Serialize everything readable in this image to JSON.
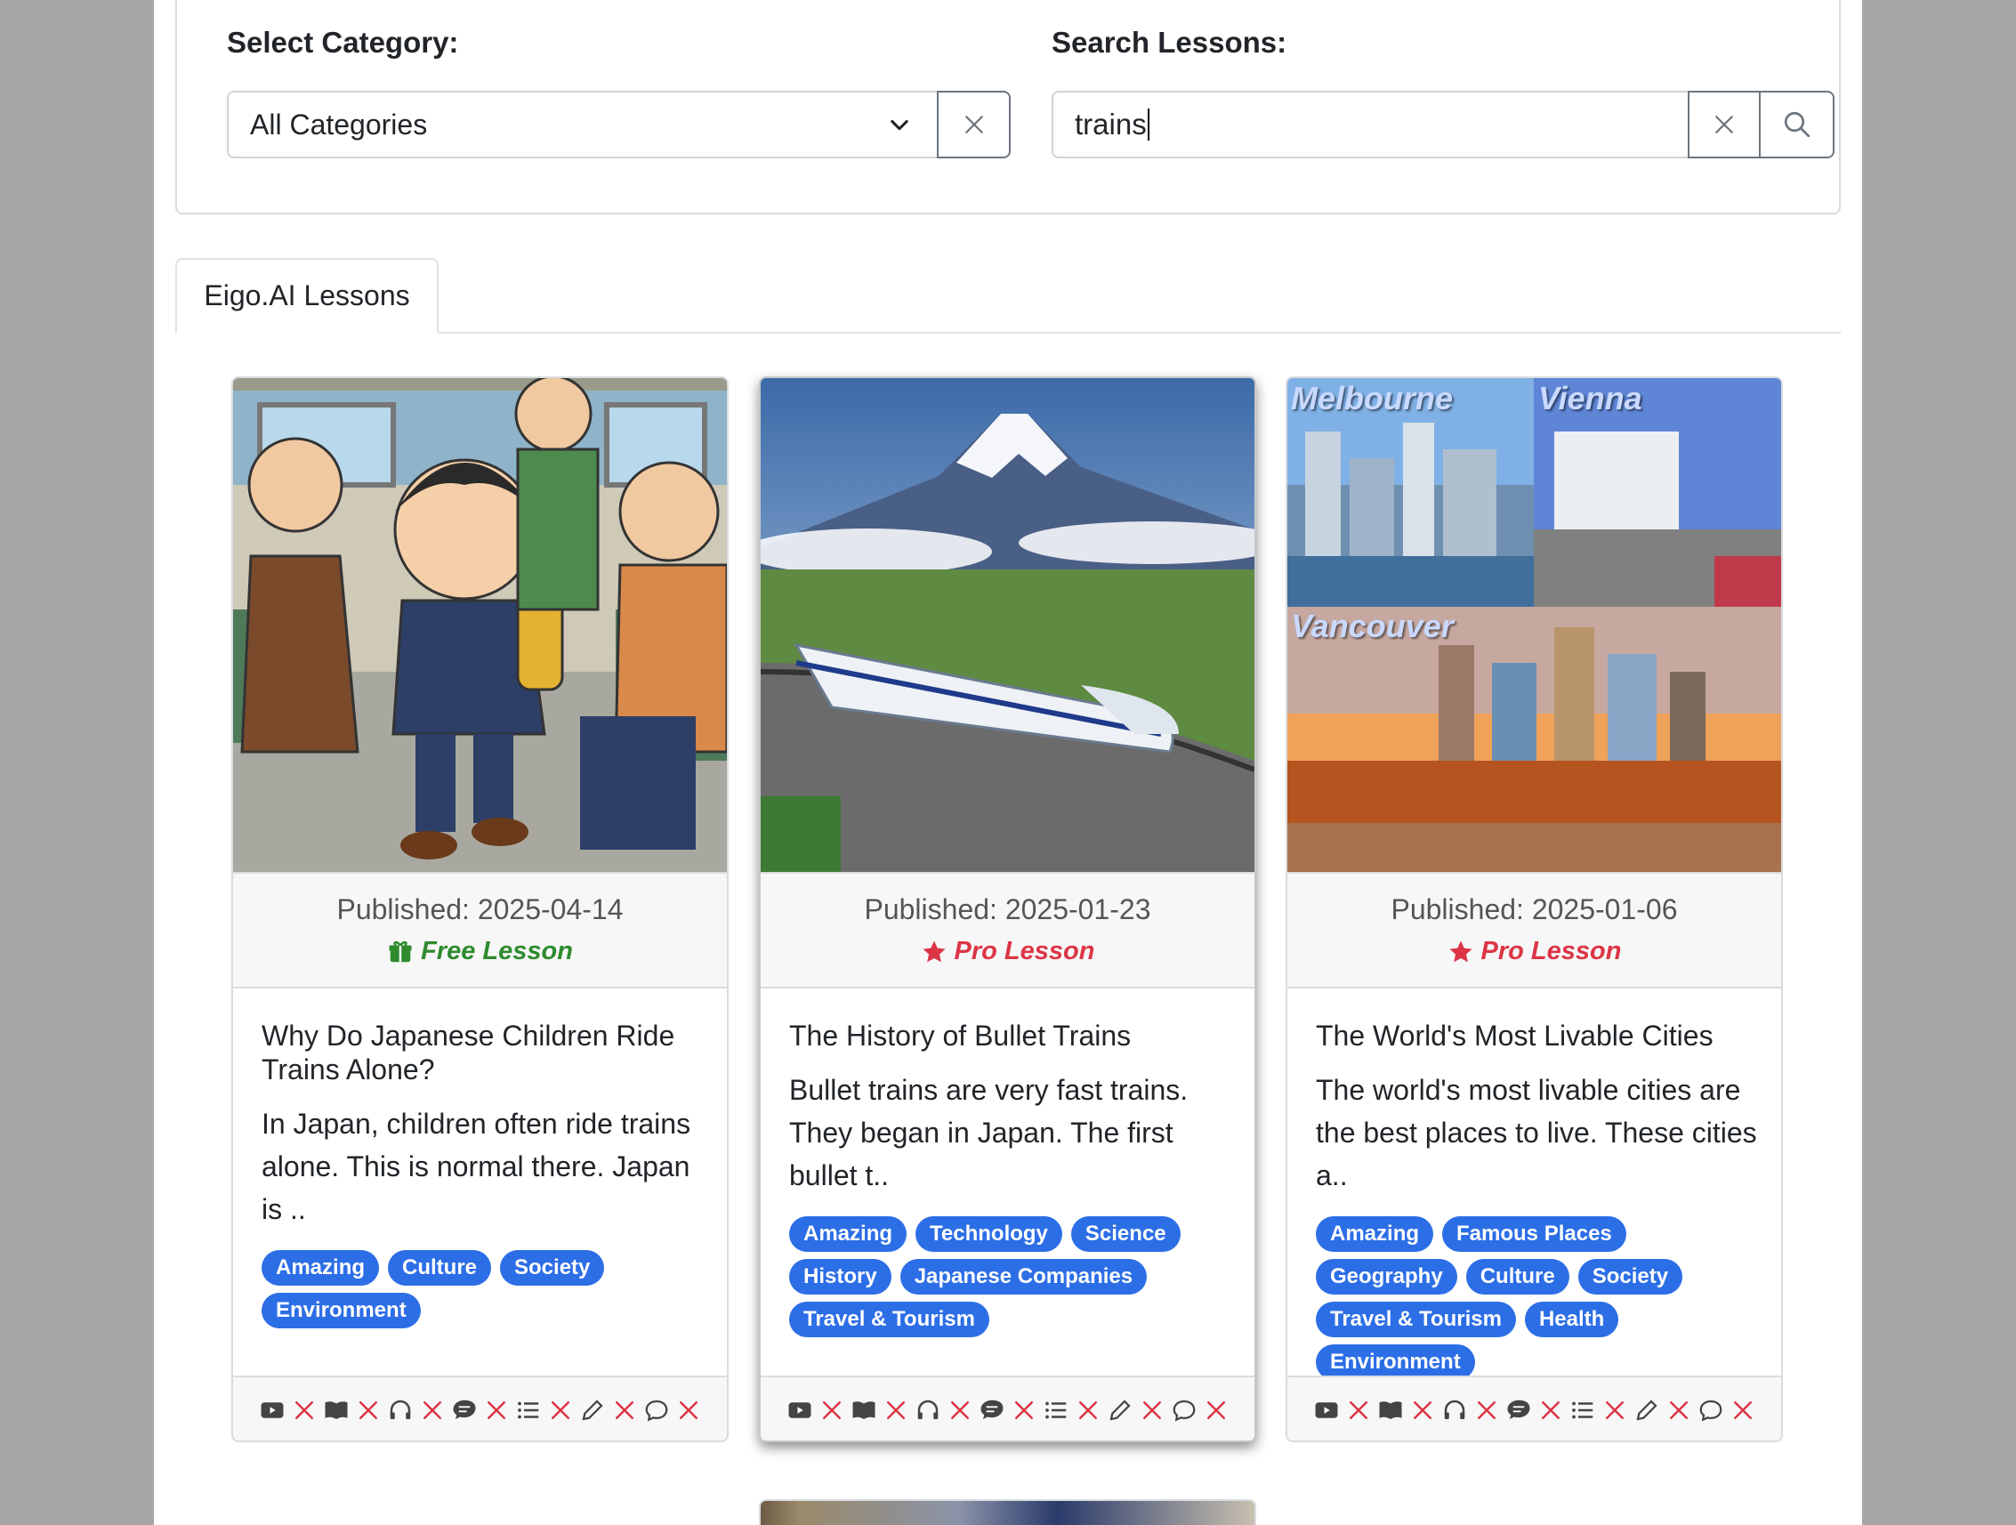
{
  "filters": {
    "category_label": "Select Category:",
    "category_selected": "All Categories",
    "search_label": "Search Lessons:",
    "search_value": "trains"
  },
  "tabs": [
    {
      "label": "Eigo.AI Lessons"
    }
  ],
  "cards": [
    {
      "published": "Published: 2025-04-14",
      "lesson_type": "Free Lesson",
      "title": "Why Do Japanese Children Ride Trains Alone?",
      "description": "In Japan, children often ride trains alone. This is normal there. Japan is ..",
      "tags": [
        "Amazing",
        "Culture",
        "Society",
        "Environment"
      ]
    },
    {
      "published": "Published: 2025-01-23",
      "lesson_type": "Pro Lesson",
      "title": "The History of Bullet Trains",
      "description": "Bullet trains are very fast trains. They began in Japan. The first bullet t..",
      "tags": [
        "Amazing",
        "Technology",
        "Science",
        "History",
        "Japanese Companies",
        "Travel & Tourism"
      ]
    },
    {
      "published": "Published: 2025-01-06",
      "lesson_type": "Pro Lesson",
      "title": "The World's Most Livable Cities",
      "description": "The world's most livable cities are the best places to live. These cities a..",
      "tags": [
        "Amazing",
        "Famous Places",
        "Geography",
        "Culture",
        "Society",
        "Travel & Tourism",
        "Health",
        "Environment"
      ],
      "image_labels": [
        "Melbourne",
        "Vienna",
        "Vancouver"
      ]
    }
  ],
  "colors": {
    "free": "#2e8b2e",
    "pro": "#dc3545",
    "tag": "#2c6ee6"
  },
  "footer_icons": [
    "video-icon",
    "book-icon",
    "headphones-icon",
    "chat-bubble-icon",
    "list-icon",
    "pencil-icon",
    "comment-icon"
  ]
}
